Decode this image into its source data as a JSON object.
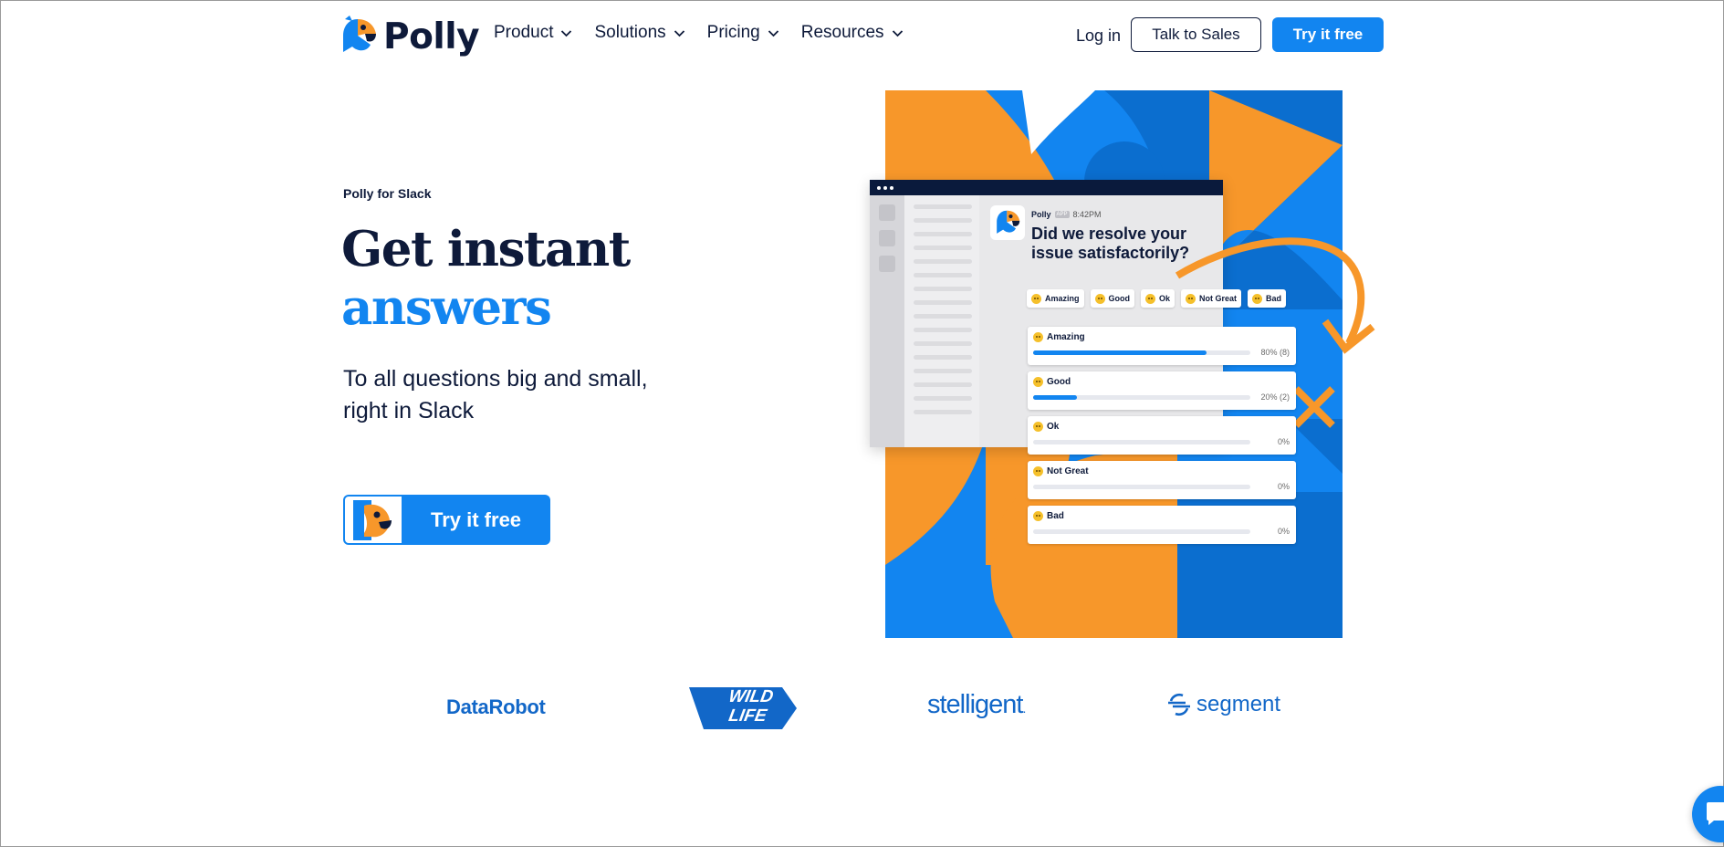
{
  "nav": {
    "logo_text": "Polly",
    "links": [
      {
        "label": "Product"
      },
      {
        "label": "Solutions"
      },
      {
        "label": "Pricing"
      },
      {
        "label": "Resources"
      }
    ],
    "login_label": "Log in",
    "sales_label": "Talk to Sales",
    "try_label": "Try it free"
  },
  "hero": {
    "eyebrow": "Polly for Slack",
    "headline_line1": "Get instant",
    "headline_line2": "answers",
    "subtext_line1": "To all questions big and small,",
    "subtext_line2": "right in Slack",
    "cta_label": "Try it free"
  },
  "slack_preview": {
    "sender": "Polly",
    "app_tag": "APP",
    "time": "8:42PM",
    "question_line1": "Did we resolve your",
    "question_line2": "issue satisfactorily?",
    "chips": [
      "Amazing",
      "Good",
      "Ok",
      "Not Great",
      "Bad"
    ],
    "results": [
      {
        "label": "Amazing",
        "pct_text": "80% (8)",
        "fraction": 0.8
      },
      {
        "label": "Good",
        "pct_text": "20% (2)",
        "fraction": 0.2
      },
      {
        "label": "Ok",
        "pct_text": "0%",
        "fraction": 0
      },
      {
        "label": "Not Great",
        "pct_text": "0%",
        "fraction": 0
      },
      {
        "label": "Bad",
        "pct_text": "0%",
        "fraction": 0
      }
    ]
  },
  "customer_logos": [
    {
      "name": "DataRobot"
    },
    {
      "name_line1": "WILD",
      "name_line2": "LIFE"
    },
    {
      "name": "stelligent",
      "suffix": "."
    },
    {
      "name": "segment"
    }
  ],
  "colors": {
    "brand_blue": "#1285f0",
    "navy": "#0e1a3a",
    "orange": "#f7972a",
    "logo_blue": "#1267c8"
  },
  "icons": {
    "logo": "parrot-icon",
    "chat": "chat-bubble-icon"
  }
}
